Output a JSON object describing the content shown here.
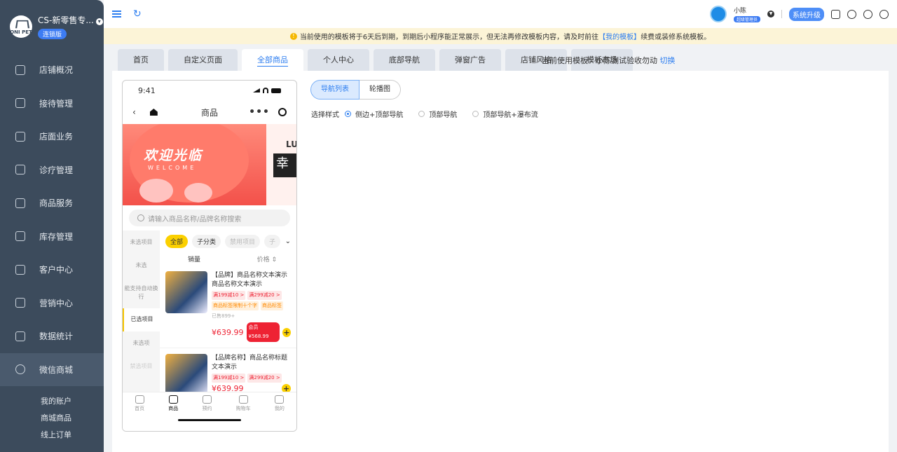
{
  "sidebar": {
    "logo_text": "ONI PET",
    "store_name": "CS-新零售专...",
    "store_tag": "连锁版",
    "items": [
      {
        "label": "店铺概况"
      },
      {
        "label": "接待管理"
      },
      {
        "label": "店面业务"
      },
      {
        "label": "诊疗管理"
      },
      {
        "label": "商品服务"
      },
      {
        "label": "库存管理"
      },
      {
        "label": "客户中心"
      },
      {
        "label": "营销中心"
      },
      {
        "label": "数据统计"
      },
      {
        "label": "微信商城"
      }
    ],
    "subitems": [
      {
        "label": "我的账户"
      },
      {
        "label": "商城商品"
      },
      {
        "label": "线上订单"
      }
    ]
  },
  "topbar": {
    "user_name": "小陈",
    "user_role": "超级管理员",
    "upgrade_label": "系统升级"
  },
  "notice": {
    "text_before": "当前使用的模板将于6天后到期，到期后小程序能正常展示，但无法再修改模板内容，请及时前往",
    "link": "【我的模板】",
    "text_after": "续费或装修系统模板。"
  },
  "tabs": [
    {
      "label": "首页"
    },
    {
      "label": "自定义页面"
    },
    {
      "label": "全部商品"
    },
    {
      "label": "个人中心"
    },
    {
      "label": "底部导航"
    },
    {
      "label": "弹窗广告"
    },
    {
      "label": "店铺风格"
    },
    {
      "label": "模板市场"
    }
  ],
  "template_info": {
    "label": "当前使用模板：小陈测试验收勿动",
    "switch_label": "切换"
  },
  "phone": {
    "time": "9:41",
    "title": "商品",
    "more": "•••",
    "banner_title": "欢迎光临",
    "banner_sub": "WELCOME",
    "banner2_a": "LU",
    "banner2_b": "幸",
    "search_placeholder": "请输入商品名称/品牌名称搜索",
    "categories": [
      {
        "label": "未选项目"
      },
      {
        "label": "未选"
      },
      {
        "label": "能支持自动换行"
      },
      {
        "label": "已选项目"
      },
      {
        "label": "未选项"
      },
      {
        "label": "禁选项目"
      }
    ],
    "chips": [
      {
        "label": "全部"
      },
      {
        "label": "子分类"
      },
      {
        "label": "禁用项目"
      },
      {
        "label": "子"
      }
    ],
    "sort_sales": "销量",
    "sort_price": "价格 ⇕",
    "products": [
      {
        "name": "【品牌】商品名称文本演示商品名称文本演示",
        "tags": [
          "满199减10 >",
          "满299减20 >"
        ],
        "tags2": [
          "商品标签限制十个字",
          "商品标签"
        ],
        "sold": "已售899+",
        "price": "¥639.99",
        "member": "会员 ¥568.99"
      },
      {
        "name": "【品牌名称】商品名称标题文本演示",
        "tags": [
          "满199减10 >",
          "满299减20 >"
        ],
        "price": "¥639.99"
      }
    ],
    "tabbar": [
      {
        "label": "首页"
      },
      {
        "label": "商品"
      },
      {
        "label": "预约"
      },
      {
        "label": "购物车"
      },
      {
        "label": "我的"
      }
    ]
  },
  "editor": {
    "seg": [
      {
        "label": "导航列表"
      },
      {
        "label": "轮播图"
      }
    ],
    "style_label": "选择样式",
    "options": [
      {
        "label": "侧边+顶部导航",
        "checked": true
      },
      {
        "label": "顶部导航",
        "checked": false
      },
      {
        "label": "顶部导航+瀑布流",
        "checked": false
      }
    ]
  },
  "colors": {
    "accent": "#2d7ef0",
    "sidebar": "#3c4b5c",
    "yellow": "#fbd000",
    "price_red": "#e23333"
  }
}
